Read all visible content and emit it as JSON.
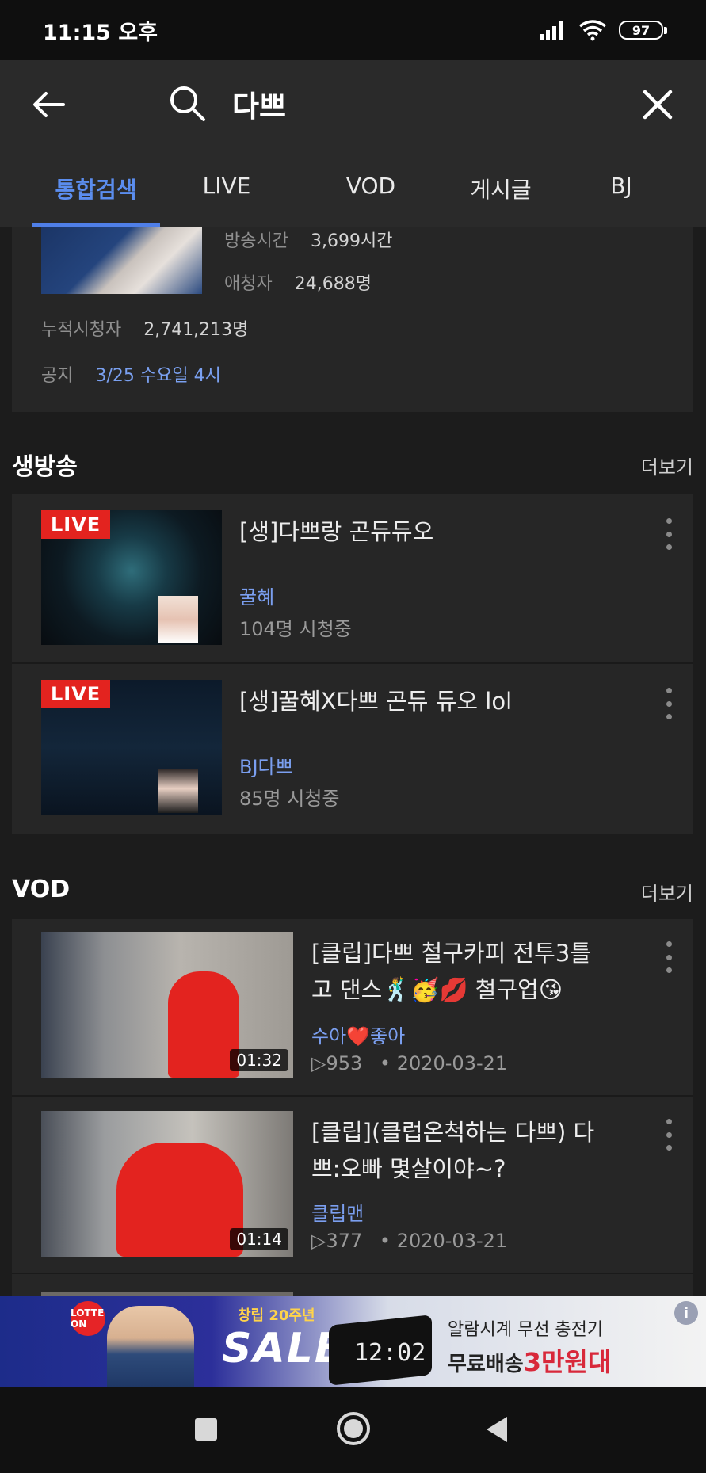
{
  "status_bar": {
    "time": "11:15 오후",
    "battery": "97"
  },
  "search": {
    "query": "다쁘"
  },
  "tabs": [
    {
      "label": "통합검색",
      "active": true
    },
    {
      "label": "LIVE",
      "active": false
    },
    {
      "label": "VOD",
      "active": false
    },
    {
      "label": "게시글",
      "active": false
    },
    {
      "label": "BJ",
      "active": false
    }
  ],
  "profile": {
    "broadcast_time_label": "방송시간",
    "broadcast_time_value": "3,699시간",
    "fans_label": "애청자",
    "fans_value": "24,688명",
    "total_viewers_label": "누적시청자",
    "total_viewers_value": "2,741,213명",
    "notice_label": "공지",
    "notice_value": "3/25 수요일 4시"
  },
  "live_section": {
    "title": "생방송",
    "more": "더보기",
    "badge": "LIVE",
    "items": [
      {
        "title": "[생]다쁘랑 곤듀듀오",
        "channel": "꿀혜",
        "viewers": "104명 시청중"
      },
      {
        "title": "[생]꿀혜X다쁘 곤듀 듀오 lol",
        "channel": "BJ다쁘",
        "viewers": "85명 시청중"
      }
    ]
  },
  "vod_section": {
    "title": "VOD",
    "more": "더보기",
    "items": [
      {
        "title_line1": "[클립]다쁘 철구카피 전투3틀",
        "title_line2": "고 댄스🕺🥳💋 철구업😘",
        "channel": "수아❤️좋아",
        "views": "▷953",
        "date": "• 2020-03-21",
        "duration": "01:32"
      },
      {
        "title_line1": "[클립](클럽온척하는 다쁘) 다",
        "title_line2": "쁘:오빠 몇살이야~?",
        "channel": "클립맨",
        "views": "▷377",
        "date": "• 2020-03-21",
        "duration": "01:14"
      }
    ]
  },
  "ad": {
    "logo": "LOTTE ON",
    "tagline": "창립 20주년",
    "sale": "SALE",
    "clock": "12:02",
    "desc": "알람시계 무선 충전기",
    "price_prefix": "무료배송",
    "price_highlight": "3만원대",
    "info": "i"
  },
  "colors": {
    "accent": "#5b8dee",
    "live": "#e3231f",
    "link": "#7b9ff0"
  }
}
